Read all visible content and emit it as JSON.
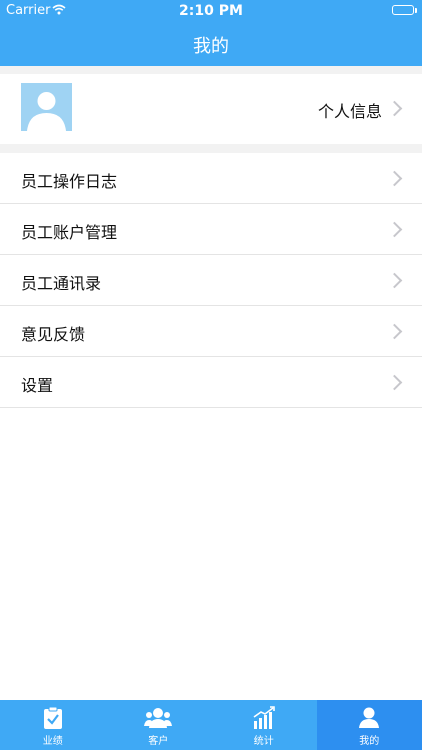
{
  "status": {
    "carrier": "Carrier",
    "time": "2:10 PM"
  },
  "nav": {
    "title": "我的"
  },
  "profile": {
    "label": "个人信息"
  },
  "menu": {
    "items": [
      {
        "label": "员工操作日志"
      },
      {
        "label": "员工账户管理"
      },
      {
        "label": "员工通讯录"
      },
      {
        "label": "意见反馈"
      },
      {
        "label": "设置"
      }
    ]
  },
  "tabs": [
    {
      "label": "业绩",
      "icon": "clipboard-check-icon"
    },
    {
      "label": "客户",
      "icon": "users-icon"
    },
    {
      "label": "统计",
      "icon": "bar-chart-icon"
    },
    {
      "label": "我的",
      "icon": "person-icon",
      "active": true
    }
  ],
  "colors": {
    "primary": "#3fa9f5",
    "active_tab": "#2d8ff0",
    "avatar_bg": "#9fd3f3"
  }
}
